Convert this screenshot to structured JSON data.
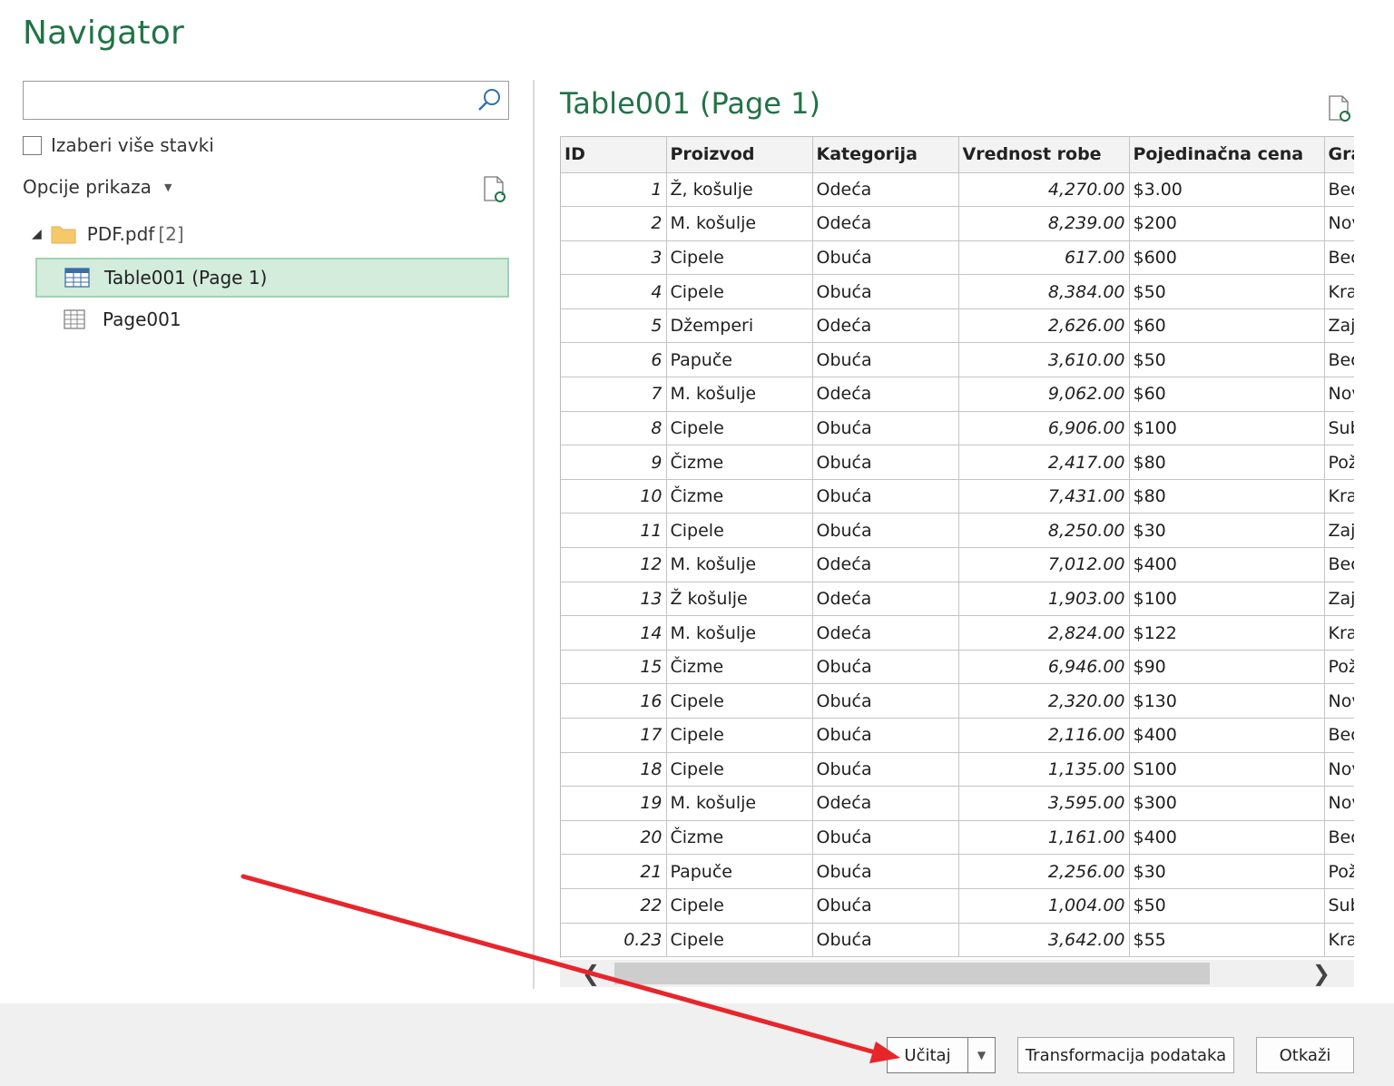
{
  "dialog": {
    "title": "Navigator"
  },
  "left": {
    "search": {
      "value": "",
      "placeholder": ""
    },
    "multi_select_label": "Izaberi više stavki",
    "view_options_label": "Opcije prikaza",
    "tree": {
      "folder_name": "PDF.pdf",
      "folder_count": "[2]",
      "items": [
        {
          "label": "Table001 (Page 1)",
          "icon": "table-icon",
          "selected": true
        },
        {
          "label": "Page001",
          "icon": "page-icon",
          "selected": false
        }
      ]
    }
  },
  "preview": {
    "title": "Table001 (Page 1)",
    "columns": [
      "ID",
      "Proizvod",
      "Kategorija",
      "Vrednost robe",
      "Pojedinačna cena",
      "Gra"
    ],
    "rows": [
      [
        "1",
        "Ž, košulje",
        "Odeća",
        "4,270.00",
        "$3.00",
        "Bec"
      ],
      [
        "2",
        "M. košulje",
        "Odeća",
        "8,239.00",
        "$200",
        "Nov"
      ],
      [
        "3",
        "Cipele",
        "Obuća",
        "617.00",
        "$600",
        "Bec"
      ],
      [
        "4",
        "Cipele",
        "Obuća",
        "8,384.00",
        "$50",
        "Kra"
      ],
      [
        "5",
        "Džemperi",
        "Odeća",
        "2,626.00",
        "$60",
        "Zaj"
      ],
      [
        "6",
        "Papuče",
        "Obuća",
        "3,610.00",
        "$50",
        "Bec"
      ],
      [
        "7",
        "M. košulje",
        "Odeća",
        "9,062.00",
        "$60",
        "Nov"
      ],
      [
        "8",
        "Cipele",
        "Obuća",
        "6,906.00",
        "$100",
        "Sub"
      ],
      [
        "9",
        "Čizme",
        "Obuća",
        "2,417.00",
        "$80",
        "Pož"
      ],
      [
        "10",
        "Čizme",
        "Obuća",
        "7,431.00",
        "$80",
        "Kra"
      ],
      [
        "11",
        "Cipele",
        "Obuća",
        "8,250.00",
        "$30",
        "Zaj"
      ],
      [
        "12",
        "M. košulje",
        "Odeća",
        "7,012.00",
        "$400",
        "Bec"
      ],
      [
        "13",
        "Ž košulje",
        "Odeća",
        "1,903.00",
        "$100",
        "Zaj"
      ],
      [
        "14",
        "M. košulje",
        "Odeća",
        "2,824.00",
        "$122",
        "Kra"
      ],
      [
        "15",
        "Čizme",
        "Obuća",
        "6,946.00",
        "$90",
        "Pož"
      ],
      [
        "16",
        "Cipele",
        "Obuća",
        "2,320.00",
        "$130",
        "Nov"
      ],
      [
        "17",
        "Cipele",
        "Obuća",
        "2,116.00",
        "$400",
        "Bec"
      ],
      [
        "18",
        "Cipele",
        "Obuća",
        "1,135.00",
        "S100",
        "Nov"
      ],
      [
        "19",
        "M. košulje",
        "Odeća",
        "3,595.00",
        "$300",
        "Nov"
      ],
      [
        "20",
        "Čizme",
        "Obuća",
        "1,161.00",
        "$400",
        "Bec"
      ],
      [
        "21",
        "Papuče",
        "Obuća",
        "2,256.00",
        "$30",
        "Pož"
      ],
      [
        "22",
        "Cipele",
        "Obuća",
        "1,004.00",
        "$50",
        "Sub"
      ],
      [
        "0.23",
        "Cipele",
        "Obuća",
        "3,642.00",
        "$55",
        "Kra"
      ]
    ]
  },
  "footer": {
    "load_label": "Učitaj",
    "transform_label": "Transformacija podataka",
    "cancel_label": "Otkaži"
  },
  "annotation": {
    "arrow_color": "#e8252b"
  },
  "colors": {
    "accent": "#217346",
    "selection_bg": "#d3ecdc"
  }
}
